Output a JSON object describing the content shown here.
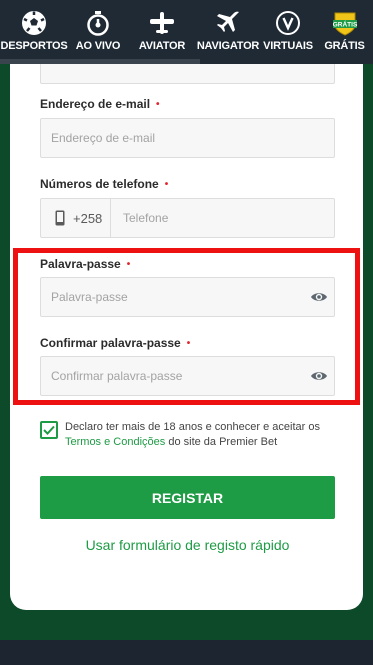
{
  "nav": {
    "items": [
      {
        "label": "DESPORTOS",
        "icon": "soccer-ball-icon"
      },
      {
        "label": "AO VIVO",
        "icon": "stopwatch-icon"
      },
      {
        "label": "AVIATOR",
        "icon": "airplane-icon"
      },
      {
        "label": "NAVIGATOR",
        "icon": "plane-icon"
      },
      {
        "label": "VIRTUAIS",
        "icon": "virtual-v-icon"
      },
      {
        "label": "GRÁTIS",
        "icon": "gratis-badge-icon",
        "badge": "GRÁTIS"
      }
    ]
  },
  "form": {
    "email": {
      "label": "Endereço de e-mail",
      "placeholder": "Endereço de e-mail"
    },
    "phone": {
      "label": "Números de telefone",
      "prefix": "+258",
      "placeholder": "Telefone"
    },
    "password": {
      "label": "Palavra-passe",
      "placeholder": "Palavra-passe"
    },
    "confirm_password": {
      "label": "Confirmar palavra-passe",
      "placeholder": "Confirmar palavra-passe"
    },
    "required_marker": "•",
    "consent": {
      "text_before": "Declaro ter mais de 18 anos e conhecer e aceitar os ",
      "link": "Termos e Condições",
      "text_after": " do site da Premier Bet",
      "checked": true
    },
    "submit_label": "REGISTAR",
    "quick_link": "Usar formulário de registo rápido"
  },
  "colors": {
    "accent": "#1e9b45",
    "highlight": "#ee1111",
    "nav_bg": "#1f2a35",
    "backdrop": "#0c4a29"
  }
}
